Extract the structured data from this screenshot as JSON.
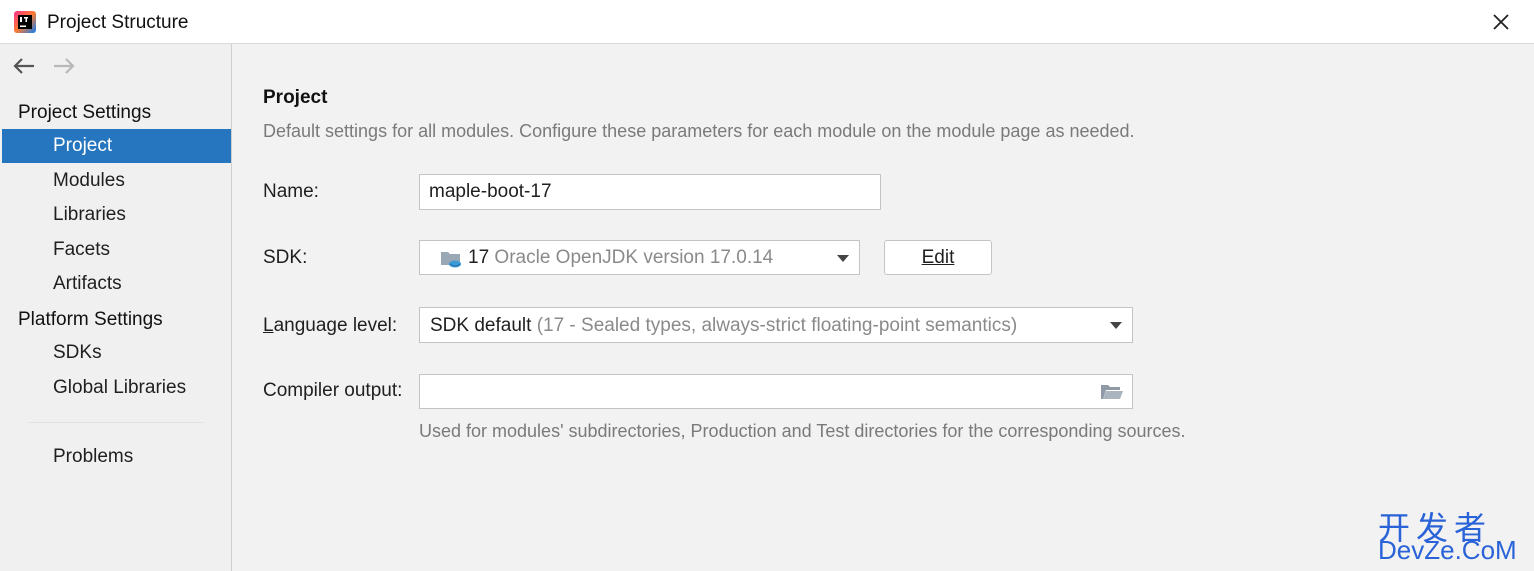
{
  "window": {
    "title": "Project Structure",
    "app_icon": "intellij-idea-icon",
    "close_icon": "close-icon"
  },
  "sidebar": {
    "back_icon": "arrow-left-icon",
    "forward_icon": "arrow-right-icon",
    "project_settings_header": "Project Settings",
    "project_settings_items": [
      {
        "label": "Project",
        "selected": true
      },
      {
        "label": "Modules"
      },
      {
        "label": "Libraries"
      },
      {
        "label": "Facets"
      },
      {
        "label": "Artifacts"
      }
    ],
    "platform_settings_header": "Platform Settings",
    "platform_settings_items": [
      {
        "label": "SDKs"
      },
      {
        "label": "Global Libraries"
      }
    ],
    "problems_label": "Problems",
    "selection_color": "#2675bf"
  },
  "main": {
    "heading": "Project",
    "description": "Default settings for all modules. Configure these parameters for each module on the module page as needed.",
    "name": {
      "label": "Name:",
      "value": "maple-boot-17"
    },
    "sdk": {
      "label": "SDK:",
      "value_version": "17",
      "value_detail": "Oracle OpenJDK version 17.0.14",
      "icon": "jdk-folder-icon",
      "edit_button": "Edit"
    },
    "language_level": {
      "label_underlined": "L",
      "label_rest": "anguage level:",
      "value": "SDK default",
      "detail": "(17 - Sealed types, always-strict floating-point semantics)"
    },
    "compiler_output": {
      "label": "Compiler output:",
      "value": "",
      "browse_icon": "folder-open-icon",
      "hint": "Used for modules' subdirectories, Production and Test directories for the corresponding sources."
    }
  },
  "watermark": {
    "line1": "开发者",
    "line2": "DevZe.CoM"
  }
}
